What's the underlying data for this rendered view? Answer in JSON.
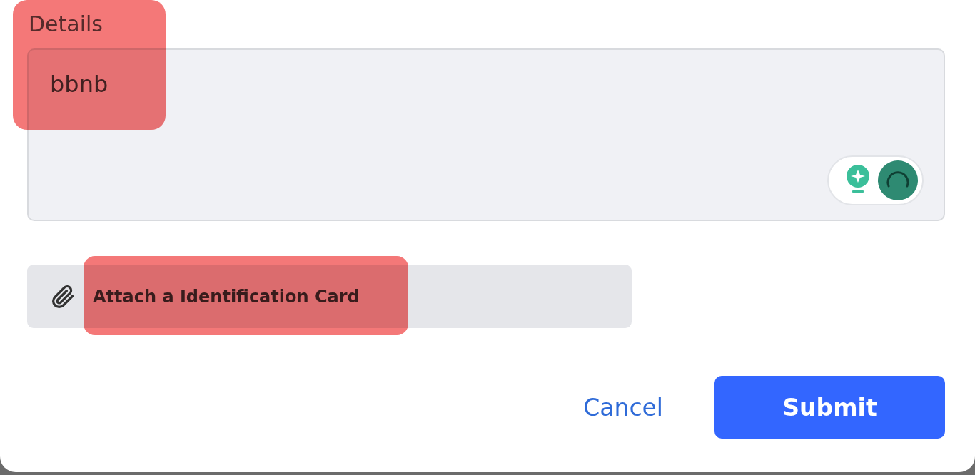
{
  "details": {
    "label": "Details",
    "value": "bbnb",
    "highlighted": true
  },
  "attachment": {
    "label": "Attach a Identification Card",
    "highlighted": true
  },
  "buttons": [
    {
      "kind": "link",
      "label": "Cancel"
    },
    {
      "kind": "primary",
      "label": "Submit"
    }
  ]
}
